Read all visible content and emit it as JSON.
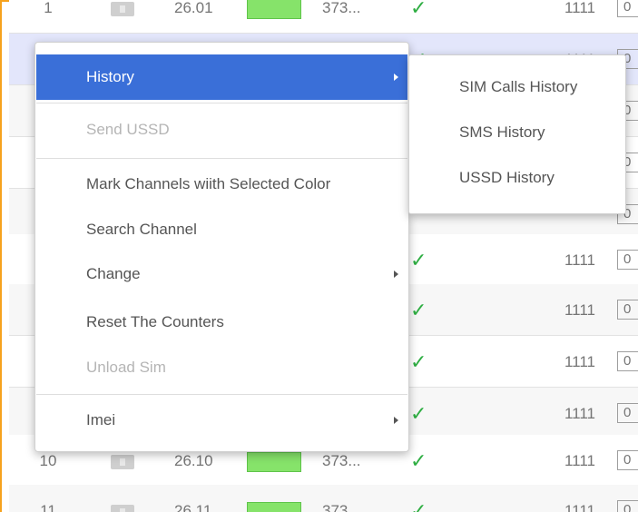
{
  "table": {
    "rows": [
      {
        "num": "1",
        "time": "26.01",
        "phone": "373...",
        "code": "1111",
        "box": "0"
      },
      {
        "num": "",
        "time": "",
        "phone": "",
        "code": "1111",
        "box": "0"
      },
      {
        "num": "",
        "time": "",
        "phone": "",
        "code": "",
        "box": "0"
      },
      {
        "num": "",
        "time": "",
        "phone": "",
        "code": "",
        "box": "0"
      },
      {
        "num": "",
        "time": "",
        "phone": "",
        "code": "1111",
        "box": "0"
      },
      {
        "num": "",
        "time": "",
        "phone": "",
        "code": "1111",
        "box": "0"
      },
      {
        "num": "",
        "time": "",
        "phone": "",
        "code": "1111",
        "box": "0"
      },
      {
        "num": "",
        "time": "",
        "phone": "",
        "code": "1111",
        "box": "0"
      },
      {
        "num": "",
        "time": "",
        "phone": "",
        "code": "1111",
        "box": "0"
      },
      {
        "num": "10",
        "time": "26.10",
        "phone": "373...",
        "code": "1111",
        "box": "0"
      },
      {
        "num": "11",
        "time": "26.11",
        "phone": "373",
        "code": "1111",
        "box": "0"
      }
    ],
    "check_glyph": "✓"
  },
  "context_menu": {
    "items": [
      {
        "label": "History"
      },
      {
        "label": "Send USSD"
      },
      {
        "label": "Mark Channels wiith Selected Color"
      },
      {
        "label": "Search Channel"
      },
      {
        "label": "Change"
      },
      {
        "label": "Reset The Counters"
      },
      {
        "label": "Unload Sim"
      },
      {
        "label": "Imei"
      }
    ]
  },
  "submenu": {
    "items": [
      {
        "label": "SIM Calls History"
      },
      {
        "label": "SMS History"
      },
      {
        "label": "USSD History"
      }
    ]
  },
  "colors": {
    "accent": "#3a6fd8",
    "frame": "#f6a21e",
    "check": "#2fae43",
    "bar": "#86e36a",
    "selected_row": "#e3e6fb"
  }
}
